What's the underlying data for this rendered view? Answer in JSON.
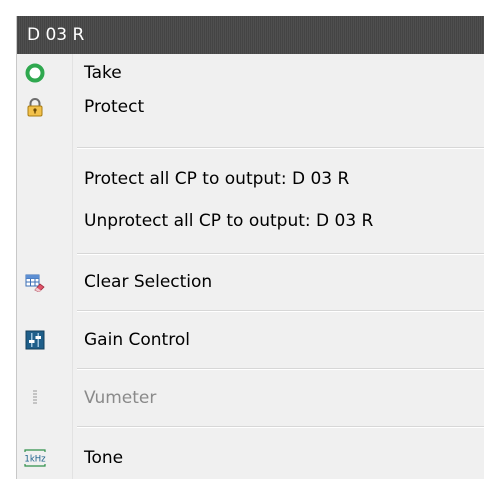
{
  "menu": {
    "header": "D 03 R",
    "items": [
      {
        "label": "Take",
        "icon": "green-circle-icon"
      },
      {
        "label": "Protect",
        "icon": "padlock-icon"
      },
      {
        "label": "Protect all CP to output: D 03 R",
        "icon": ""
      },
      {
        "label": "Unprotect all CP to output: D 03 R",
        "icon": ""
      },
      {
        "label": "Clear Selection",
        "icon": "grid-eraser-icon"
      },
      {
        "label": "Gain Control",
        "icon": "gain-control-icon"
      },
      {
        "label": "Vumeter",
        "icon": "vumeter-icon",
        "disabled": true
      },
      {
        "label": "Tone",
        "icon": "1khz-tone-icon"
      }
    ]
  },
  "colors": {
    "header_bg": "#4a4a4a",
    "menu_bg": "#f0f0f0",
    "take_green": "#2fa84f"
  }
}
